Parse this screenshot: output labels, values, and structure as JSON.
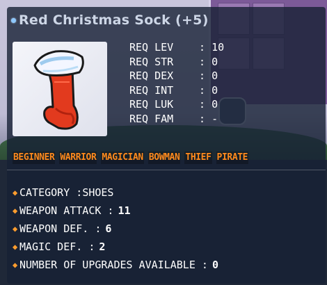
{
  "item": {
    "name": "Red Christmas Sock (+5)",
    "icon": "red-christmas-sock"
  },
  "requirements": [
    {
      "label": "REQ LEV",
      "value": "10"
    },
    {
      "label": "REQ STR",
      "value": "0"
    },
    {
      "label": "REQ DEX",
      "value": "0"
    },
    {
      "label": "REQ INT",
      "value": "0"
    },
    {
      "label": "REQ LUK",
      "value": "0"
    },
    {
      "label": "REQ FAM",
      "value": "-"
    }
  ],
  "jobs": [
    "BEGINNER",
    "WARRIOR",
    "MAGICIAN",
    "BOWMAN",
    "THIEF",
    "PIRATE"
  ],
  "stats": [
    {
      "label": "CATEGORY :",
      "value": "SHOES"
    },
    {
      "label": "WEAPON ATTACK :",
      "value": "11"
    },
    {
      "label": "WEAPON DEF. :",
      "value": "6"
    },
    {
      "label": "MAGIC DEF. :",
      "value": "2"
    },
    {
      "label": "NUMBER OF UPGRADES AVAILABLE :",
      "value": "0"
    }
  ],
  "colors": {
    "job_text": "#ff8a1c",
    "bullet": "#ff9d2e",
    "title": "#cdd6e6"
  }
}
